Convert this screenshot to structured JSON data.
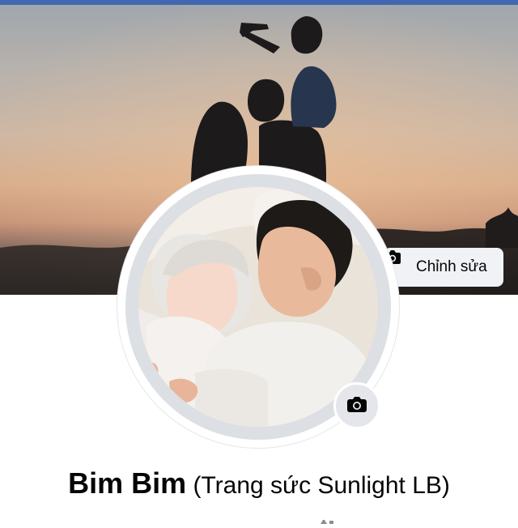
{
  "header": {
    "accent_color": "#4267b2"
  },
  "cover": {
    "edit_button_label": "Chỉnh sửa",
    "edit_icon": "camera-icon"
  },
  "avatar": {
    "camera_icon": "camera-icon"
  },
  "profile": {
    "name": "Bim Bim",
    "alternate_name": " (Trang sức Sunlight LB)"
  }
}
